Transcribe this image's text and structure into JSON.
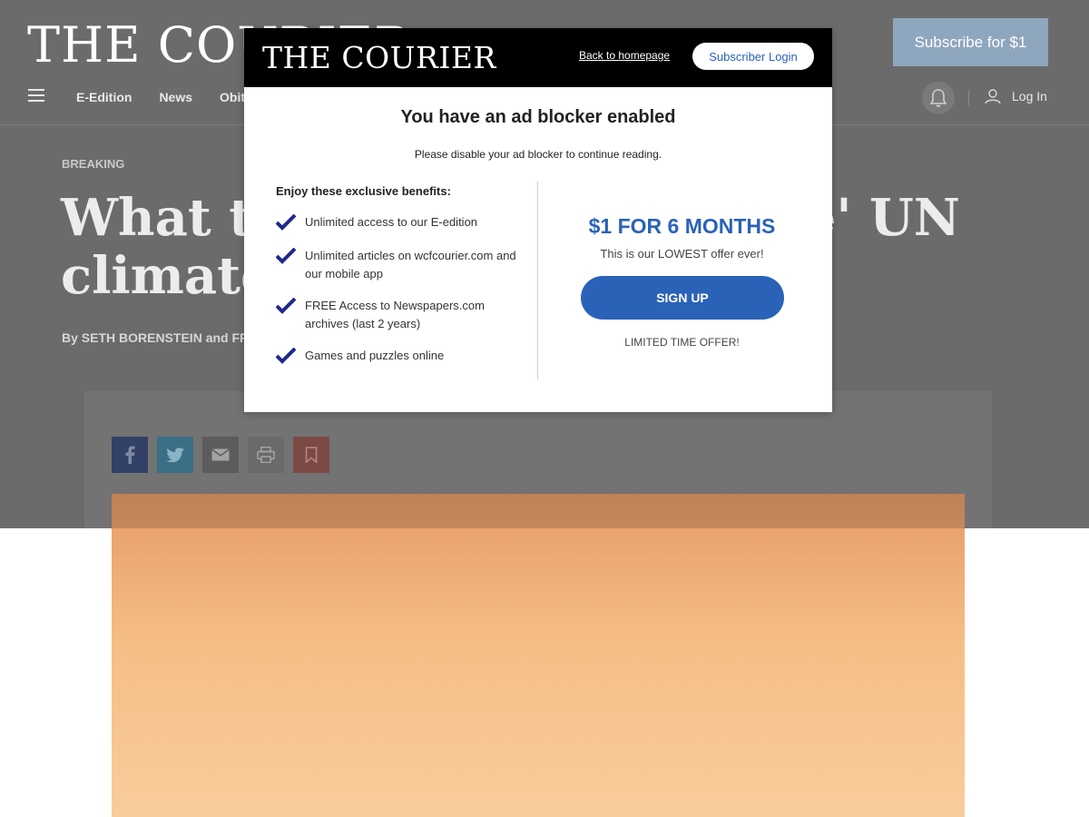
{
  "site": {
    "masthead": "THE COURIER",
    "subscribe_label": "Subscribe for $1",
    "nav": {
      "items": [
        "E-Edition",
        "News",
        "Obit"
      ],
      "login_label": "Log In"
    }
  },
  "article": {
    "kicker": "BREAKING",
    "headline": "What to climate fire' UN",
    "headline_left_1": "What to",
    "headline_right_1": "fire' UN",
    "headline_left_2": "climate r",
    "byline": "By SETH BORENSTEIN and FR"
  },
  "modal": {
    "logo": "THE COURIER",
    "back_link": "Back to homepage",
    "login_button": "Subscriber Login",
    "title": "You have an ad blocker enabled",
    "subtitle": "Please disable your ad blocker to continue reading.",
    "benefits_heading": "Enjoy these exclusive benefits:",
    "benefits": [
      "Unlimited access to our E-edition",
      "Unlimited articles on wcfcourier.com and our mobile app",
      "FREE Access to Newspapers.com archives (last 2 years)",
      "Games and puzzles online"
    ],
    "offer": "$1 FOR 6 MONTHS",
    "offer_sub": "This is our LOWEST offer ever!",
    "signup_button": "SIGN UP",
    "limited": "LIMITED TIME OFFER!"
  },
  "colors": {
    "accent": "#2a62b8",
    "check": "#1e2a8a",
    "overlay": "#6b6b6b"
  },
  "icons": [
    "menu-icon",
    "bell-icon",
    "user-icon",
    "facebook-icon",
    "twitter-icon",
    "email-icon",
    "print-icon",
    "bookmark-icon",
    "check-icon"
  ]
}
